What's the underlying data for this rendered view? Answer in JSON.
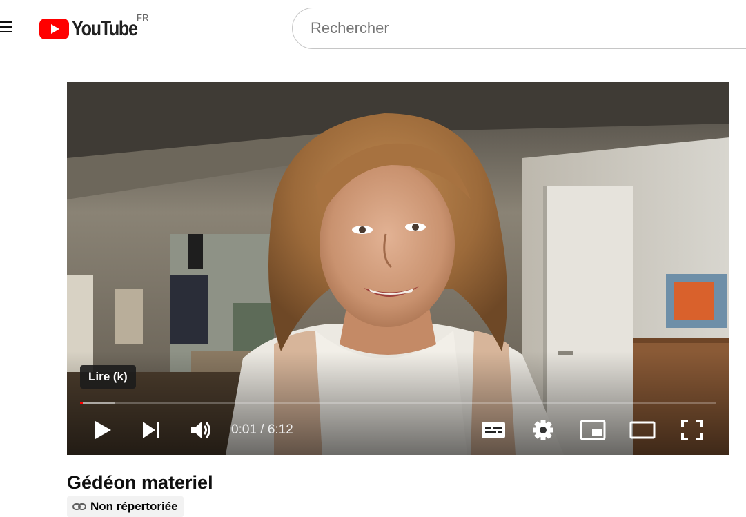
{
  "header": {
    "logo_text": "YouTube",
    "country_code": "FR",
    "search": {
      "placeholder": "Rechercher",
      "value": ""
    }
  },
  "player": {
    "tooltip": "Lire (k)",
    "current_time": "0:01",
    "duration": "6:12",
    "time_display": "0:01 / 6:12",
    "progress_played_fraction": 0.003,
    "progress_loaded_fraction": 0.055,
    "icons": {
      "play": "play-icon",
      "next": "next-icon",
      "volume": "volume-icon",
      "subtitles": "subtitles-icon",
      "settings": "gear-icon",
      "miniplayer": "miniplayer-icon",
      "theater": "theater-mode-icon",
      "fullscreen": "fullscreen-icon"
    }
  },
  "video": {
    "title": "Gédéon materiel",
    "visibility_badge": "Non répertoriée"
  },
  "colors": {
    "brand_red": "#ff0000",
    "text": "#0f0f0f"
  }
}
